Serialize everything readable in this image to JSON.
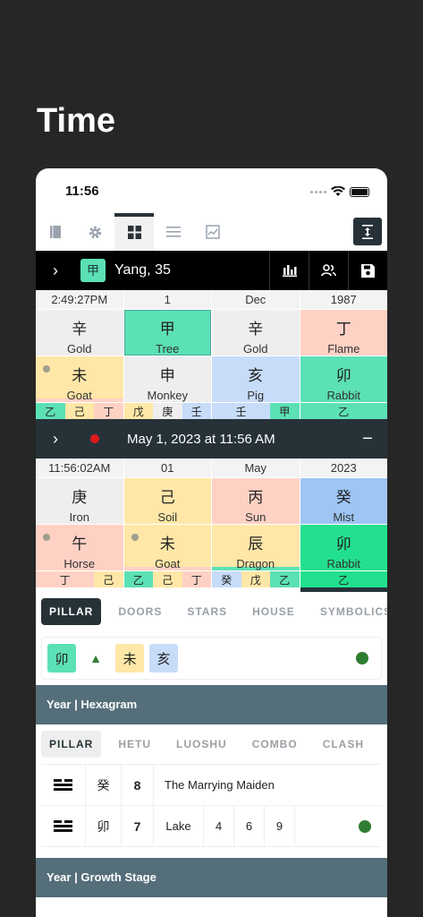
{
  "page_title": "Time",
  "status": {
    "time": "11:56"
  },
  "toolbar": {
    "icons": [
      "book-icon",
      "gear-icon",
      "grid-icon",
      "list-icon",
      "chart-icon"
    ],
    "right_icon": "expand-icon"
  },
  "bar1": {
    "badge": "甲",
    "title": "Yang, 35"
  },
  "natal": {
    "headers": [
      "2:49:27PM",
      "1",
      "Dec",
      "1987"
    ],
    "stems": [
      {
        "ch": "辛",
        "name": "Gold"
      },
      {
        "ch": "甲",
        "name": "Tree"
      },
      {
        "ch": "辛",
        "name": "Gold"
      },
      {
        "ch": "丁",
        "name": "Flame"
      }
    ],
    "branches": [
      {
        "ch": "未",
        "name": "Goat"
      },
      {
        "ch": "申",
        "name": "Monkey"
      },
      {
        "ch": "亥",
        "name": "Pig"
      },
      {
        "ch": "卯",
        "name": "Rabbit"
      }
    ],
    "hidden": [
      [
        "乙",
        "己",
        "丁"
      ],
      [
        "戊",
        "庚",
        "壬"
      ],
      [
        "壬",
        "甲"
      ],
      [
        "乙"
      ]
    ]
  },
  "bar2": {
    "title": "May 1, 2023 at 11:56 AM"
  },
  "current": {
    "headers": [
      "11:56:02AM",
      "01",
      "May",
      "2023"
    ],
    "stems": [
      {
        "ch": "庚",
        "name": "Iron"
      },
      {
        "ch": "己",
        "name": "Soil"
      },
      {
        "ch": "丙",
        "name": "Sun"
      },
      {
        "ch": "癸",
        "name": "Mist"
      }
    ],
    "branches": [
      {
        "ch": "午",
        "name": "Horse"
      },
      {
        "ch": "未",
        "name": "Goat"
      },
      {
        "ch": "辰",
        "name": "Dragon"
      },
      {
        "ch": "卯",
        "name": "Rabbit"
      }
    ],
    "hidden": [
      [
        "丁",
        "己"
      ],
      [
        "乙",
        "己",
        "丁"
      ],
      [
        "癸",
        "戊",
        "乙"
      ],
      [
        "乙"
      ]
    ]
  },
  "tabs1": [
    "PILLAR",
    "DOORS",
    "STARS",
    "HOUSE",
    "SYMBOLICS"
  ],
  "chips": {
    "a": "卯",
    "b": "未",
    "c": "亥"
  },
  "section1": "Year | Hexagram",
  "tabs2": [
    "PILLAR",
    "HETU",
    "LUOSHU",
    "COMBO",
    "CLASH"
  ],
  "hex_rows": [
    {
      "ch": "癸",
      "num": "8",
      "name": "The Marrying Maiden"
    },
    {
      "ch": "卯",
      "num": "7",
      "name": "Lake",
      "a": "4",
      "b": "6",
      "c": "9"
    }
  ],
  "section2": "Year | Growth Stage"
}
